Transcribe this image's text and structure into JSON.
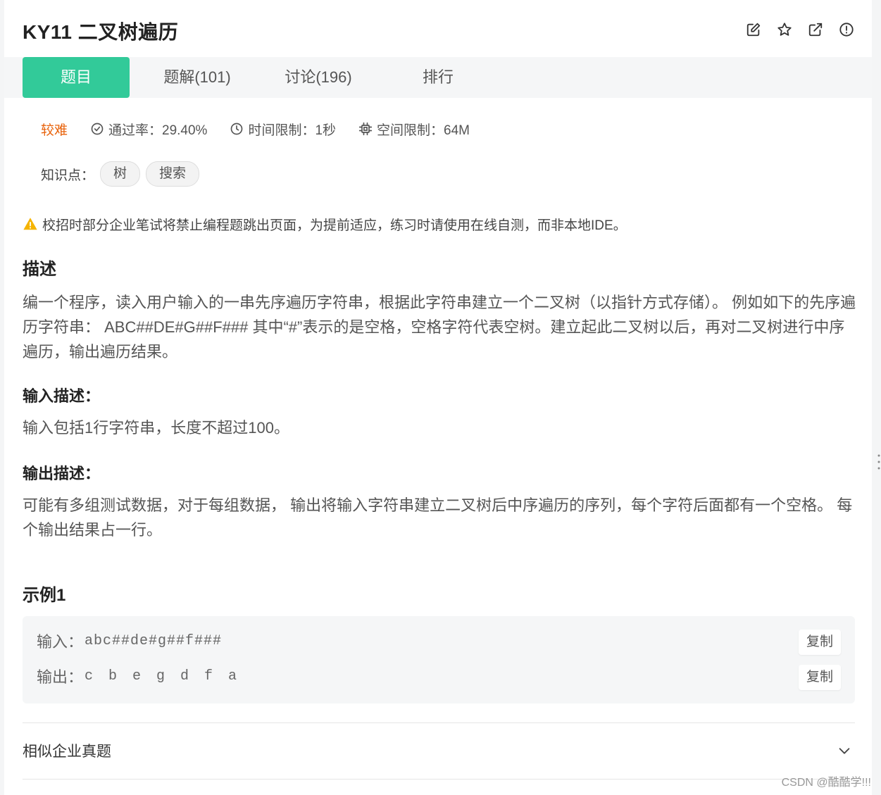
{
  "problem": {
    "title": "KY11  二叉树遍历"
  },
  "header_icons": [
    "edit-icon",
    "star-icon",
    "share-icon",
    "report-icon"
  ],
  "tabs": [
    {
      "label": "题目",
      "active": true
    },
    {
      "label": "题解(101)",
      "active": false
    },
    {
      "label": "讨论(196)",
      "active": false
    },
    {
      "label": "排行",
      "active": false
    }
  ],
  "meta": {
    "difficulty": "较难",
    "pass_rate": "通过率：29.40%",
    "time_limit": "时间限制：1秒",
    "memory_limit": "空间限制：64M"
  },
  "knowledge": {
    "label": "知识点：",
    "tags": [
      "树",
      "搜索"
    ]
  },
  "notice": "校招时部分企业笔试将禁止编程题跳出页面，为提前适应，练习时请使用在线自测，而非本地IDE。",
  "description": {
    "title": "描述",
    "text": "编一个程序，读入用户输入的一串先序遍历字符串，根据此字符串建立一个二叉树（以指针方式存储）。 例如如下的先序遍历字符串： ABC##DE#G##F### 其中“#”表示的是空格，空格字符代表空树。建立起此二叉树以后，再对二叉树进行中序遍历，输出遍历结果。"
  },
  "input_desc": {
    "title": "输入描述：",
    "text": "输入包括1行字符串，长度不超过100。"
  },
  "output_desc": {
    "title": "输出描述：",
    "text": "可能有多组测试数据，对于每组数据， 输出将输入字符串建立二叉树后中序遍历的序列，每个字符后面都有一个空格。 每个输出结果占一行。"
  },
  "example": {
    "title": "示例1",
    "input_label": "输入：",
    "input_value": "abc##de#g##f###",
    "output_label": "输出：",
    "output_value": "c b e g d f a",
    "copy_label": "复制"
  },
  "similar": {
    "label": "相似企业真题"
  },
  "watermark": "CSDN @酷酷学!!!",
  "colors": {
    "accent": "#32ca99",
    "difficulty": "#e8620b",
    "warning": "#f5b400"
  }
}
